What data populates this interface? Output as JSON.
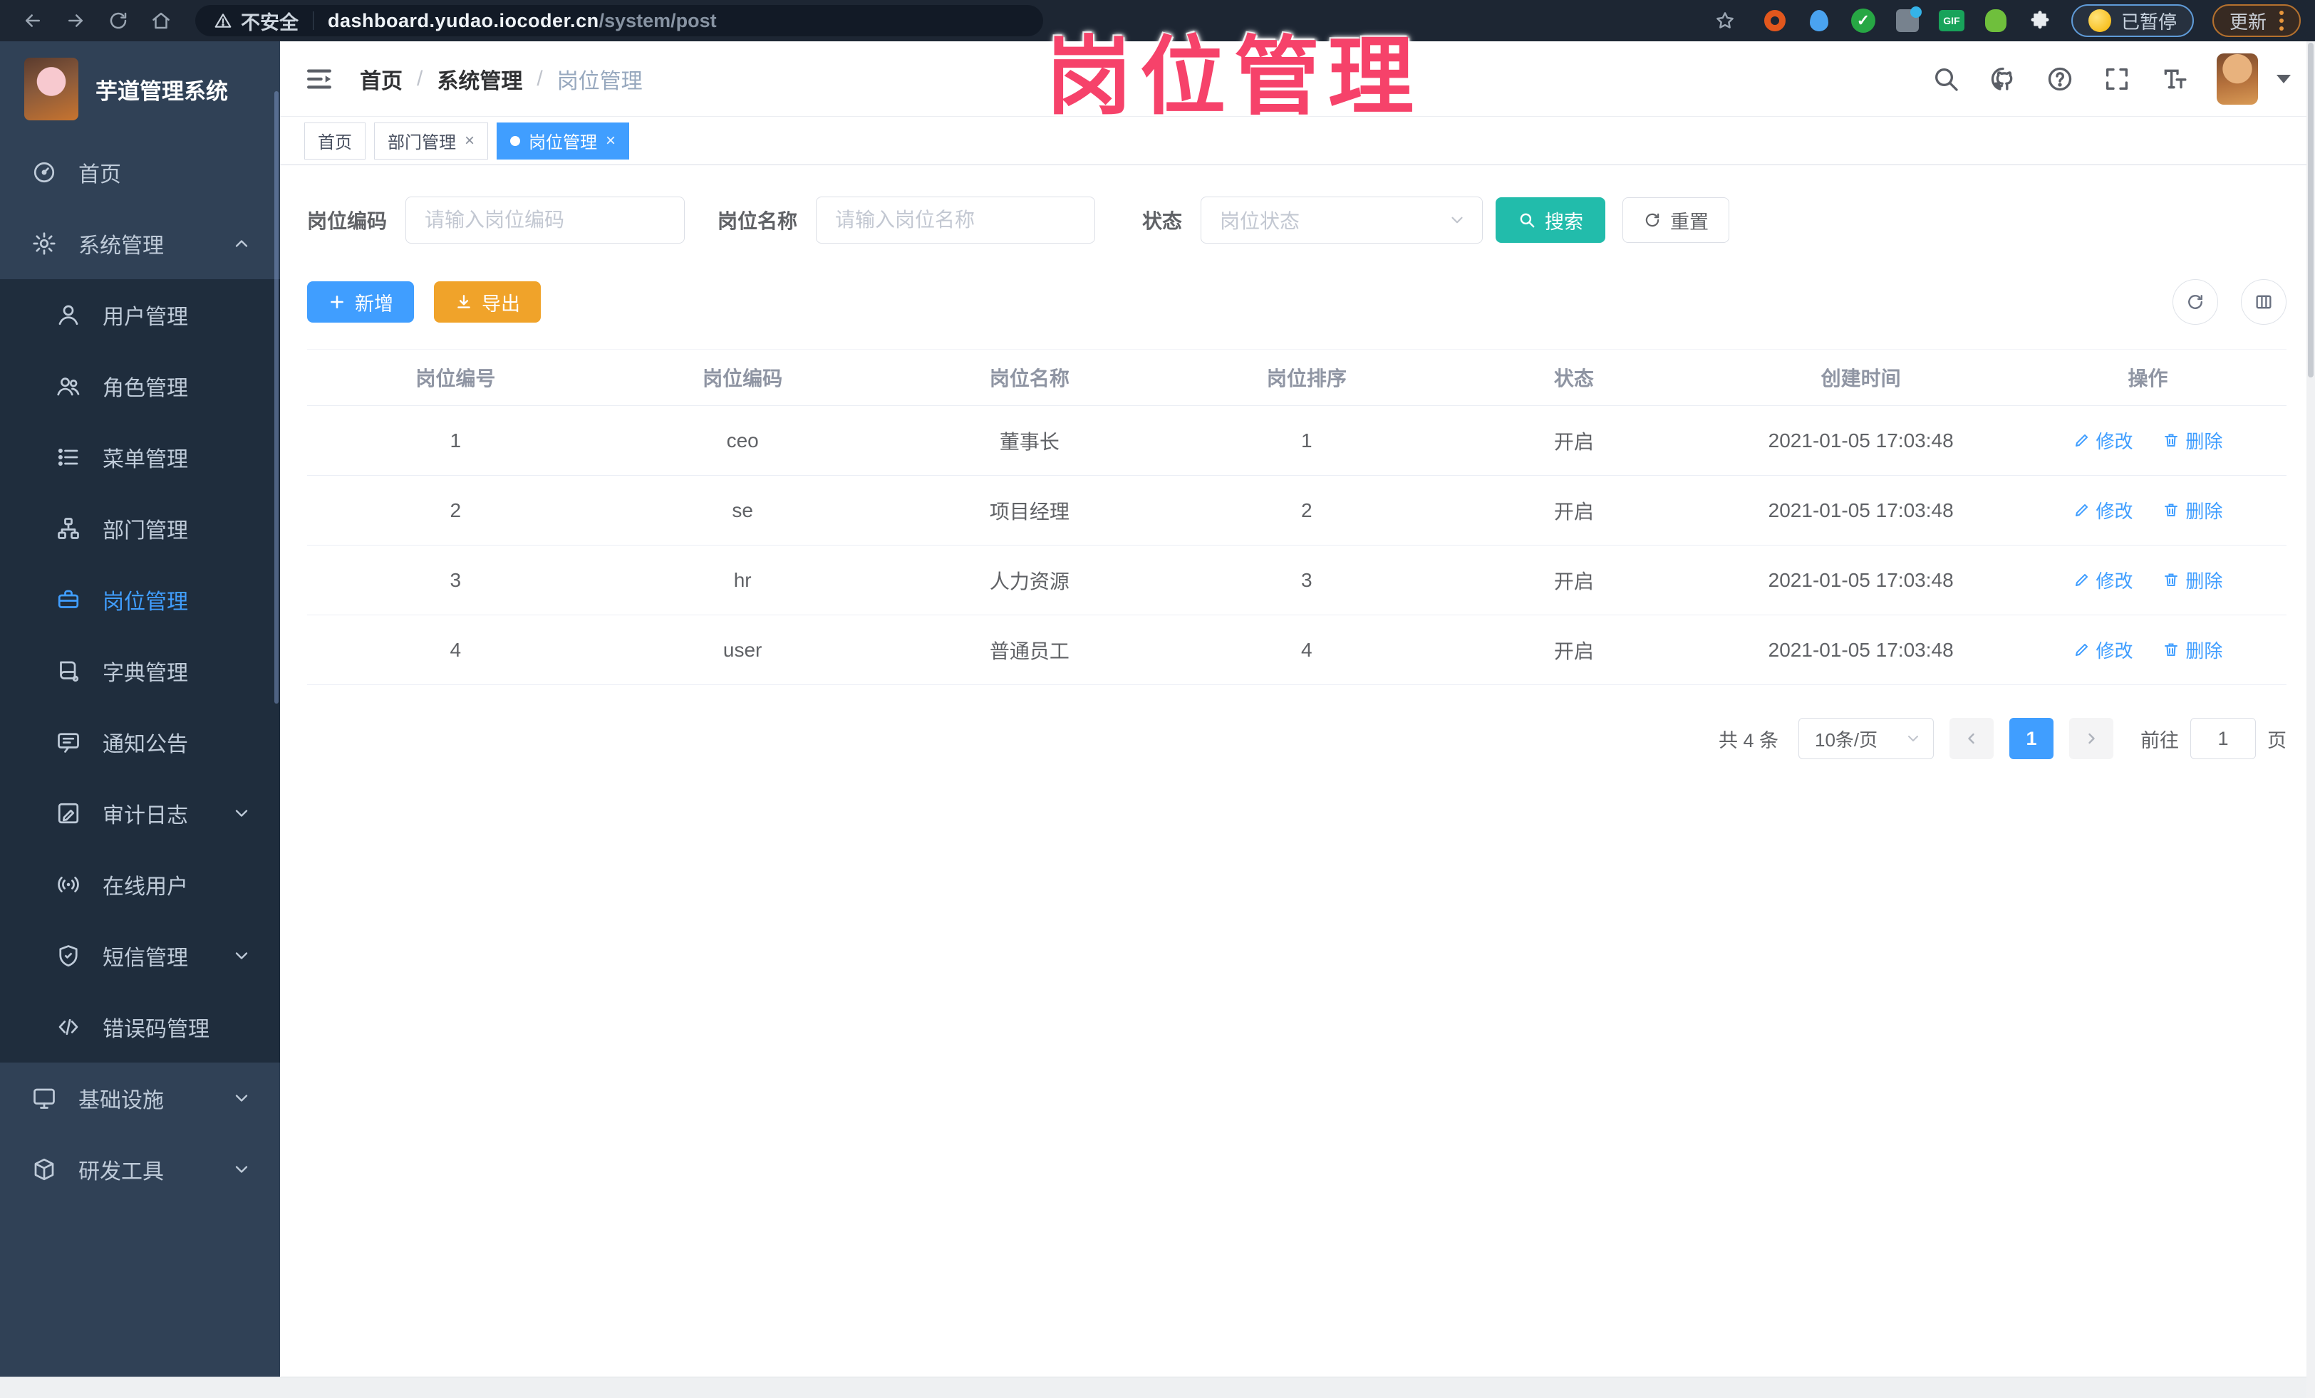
{
  "browser": {
    "security_label": "不安全",
    "url_host": "dashboard.yudao.iocoder.cn",
    "url_path": "/system/post",
    "gif_badge": "GIF",
    "paused_label": "已暂停",
    "update_label": "更新"
  },
  "watermark": "岗位管理",
  "sidebar": {
    "app_title": "芋道管理系统",
    "items": [
      {
        "label": "首页"
      },
      {
        "label": "系统管理"
      },
      {
        "label": "用户管理"
      },
      {
        "label": "角色管理"
      },
      {
        "label": "菜单管理"
      },
      {
        "label": "部门管理"
      },
      {
        "label": "岗位管理"
      },
      {
        "label": "字典管理"
      },
      {
        "label": "通知公告"
      },
      {
        "label": "审计日志"
      },
      {
        "label": "在线用户"
      },
      {
        "label": "短信管理"
      },
      {
        "label": "错误码管理"
      },
      {
        "label": "基础设施"
      },
      {
        "label": "研发工具"
      }
    ]
  },
  "breadcrumb": {
    "items": [
      "首页",
      "系统管理",
      "岗位管理"
    ],
    "separator": "/"
  },
  "tabs": [
    {
      "label": "首页"
    },
    {
      "label": "部门管理"
    },
    {
      "label": "岗位管理"
    }
  ],
  "filters": {
    "post_code_label": "岗位编码",
    "post_code_placeholder": "请输入岗位编码",
    "post_name_label": "岗位名称",
    "post_name_placeholder": "请输入岗位名称",
    "status_label": "状态",
    "status_placeholder": "岗位状态",
    "search_label": "搜索",
    "reset_label": "重置"
  },
  "toolbar": {
    "add_label": "新增",
    "export_label": "导出"
  },
  "table": {
    "columns": [
      "岗位编号",
      "岗位编码",
      "岗位名称",
      "岗位排序",
      "状态",
      "创建时间",
      "操作"
    ],
    "edit_label": "修改",
    "delete_label": "删除",
    "rows": [
      {
        "id": "1",
        "code": "ceo",
        "name": "董事长",
        "sort": "1",
        "status": "开启",
        "created": "2021-01-05 17:03:48"
      },
      {
        "id": "2",
        "code": "se",
        "name": "项目经理",
        "sort": "2",
        "status": "开启",
        "created": "2021-01-05 17:03:48"
      },
      {
        "id": "3",
        "code": "hr",
        "name": "人力资源",
        "sort": "3",
        "status": "开启",
        "created": "2021-01-05 17:03:48"
      },
      {
        "id": "4",
        "code": "user",
        "name": "普通员工",
        "sort": "4",
        "status": "开启",
        "created": "2021-01-05 17:03:48"
      }
    ]
  },
  "pagination": {
    "total_text": "共 4 条",
    "page_size": "10条/页",
    "current_page": "1",
    "goto_label": "前往",
    "goto_value": "1",
    "page_unit": "页"
  },
  "colors": {
    "primary": "#409eff",
    "search_teal": "#22bcab",
    "export_orange": "#f0a32a",
    "sidebar_bg": "#304156",
    "submenu_bg": "#1f2d3d",
    "browser_bar_bg": "#1d2633",
    "watermark_pink": "#f6426a"
  }
}
